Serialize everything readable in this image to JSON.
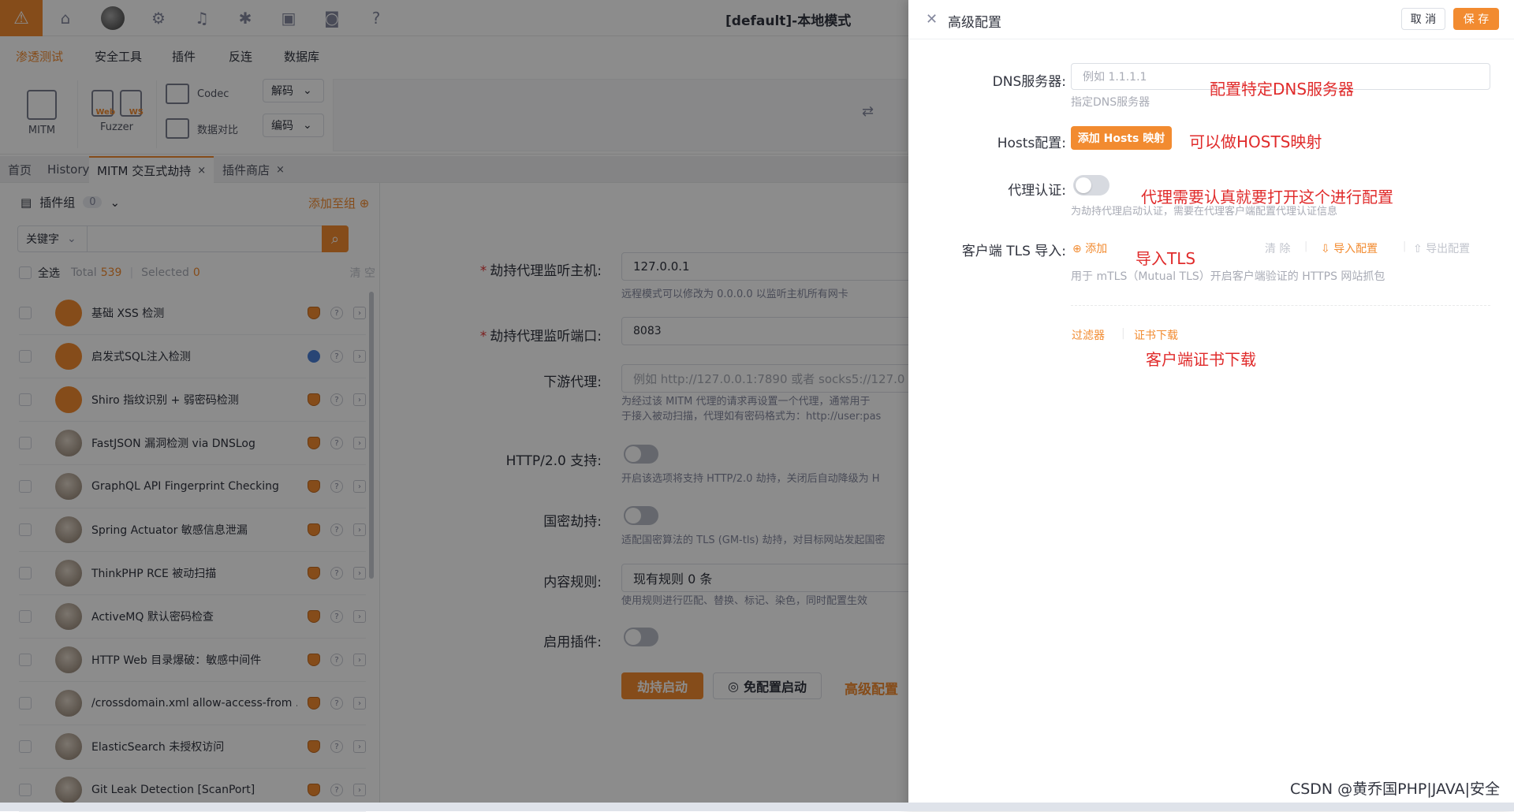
{
  "window": {
    "title": "[default]-本地模式"
  },
  "topbar": {
    "icons": [
      "warning-icon",
      "home-icon",
      "avatar",
      "settings-icon",
      "bell-icon",
      "bug-icon",
      "terminal-icon",
      "camera-icon",
      "help-icon"
    ]
  },
  "menu": [
    "渗透测试",
    "安全工具",
    "插件",
    "反连",
    "数据库"
  ],
  "tools": {
    "mitm": "MITM",
    "fuzzer": "Fuzzer",
    "codec": "Codec",
    "compare": "数据对比",
    "decode": "解码",
    "encode": "编码",
    "web_tag": "Web",
    "ws_tag": "WS"
  },
  "tabs": [
    {
      "label": "首页"
    },
    {
      "label": "History"
    },
    {
      "label": "MITM 交互式劫持",
      "close": "×"
    },
    {
      "label": "插件商店",
      "close": "×"
    }
  ],
  "plugins": {
    "group_label": "插件组",
    "group_count": "0",
    "add_to_group": "添加至组",
    "keyword_label": "关键字",
    "select_all": "全选",
    "total_label": "Total",
    "total": "539",
    "selected_label": "Selected",
    "selected": "0",
    "clear": "清 空",
    "items": [
      {
        "name": "基础 XSS 检测"
      },
      {
        "name": "启发式SQL注入检测"
      },
      {
        "name": "Shiro 指纹识别 + 弱密码检测"
      },
      {
        "name": "FastJSON 漏洞检测 via DNSLog"
      },
      {
        "name": "GraphQL API Fingerprint Checking"
      },
      {
        "name": "Spring Actuator 敏感信息泄漏"
      },
      {
        "name": "ThinkPHP RCE 被动扫描"
      },
      {
        "name": "ActiveMQ 默认密码检查"
      },
      {
        "name": "HTTP Web 目录爆破：敏感中间件"
      },
      {
        "name": "/crossdomain.xml allow-access-from ..."
      },
      {
        "name": "ElasticSearch 未授权访问"
      },
      {
        "name": "Git Leak Detection [ScanPort]"
      }
    ]
  },
  "mitm_form": {
    "host_label": "劫持代理监听主机:",
    "host_value": "127.0.0.1",
    "host_help": "远程模式可以修改为 0.0.0.0 以监听主机所有网卡",
    "port_label": "劫持代理监听端口:",
    "port_value": "8083",
    "downstream_label": "下游代理:",
    "downstream_placeholder": "例如 http://127.0.0.1:7890 或者 socks5://127.0",
    "downstream_help1": "为经过该 MITM 代理的请求再设置一个代理，通常用于",
    "downstream_help2": "于接入被动扫描，代理如有密码格式为：http://user:pas",
    "http2_label": "HTTP/2.0 支持:",
    "http2_help": "开启该选项将支持 HTTP/2.0 劫持，关闭后自动降级为 H",
    "gm_label": "国密劫持:",
    "gm_help": "适配国密算法的 TLS (GM-tls) 劫持，对目标网站发起国密",
    "rules_label": "内容规则:",
    "rules_value": "现有规则 0 条",
    "rules_help": "使用规则进行匹配、替换、标记、染色，同时配置生效",
    "enable_plugin_label": "启用插件:",
    "start_btn": "劫持启动",
    "free_start_btn": "免配置启动",
    "advanced_link": "高级配置"
  },
  "drawer": {
    "title": "高级配置",
    "cancel": "取 消",
    "save": "保 存",
    "dns_label": "DNS服务器:",
    "dns_placeholder": "例如 1.1.1.1",
    "dns_help": "指定DNS服务器",
    "hosts_label": "Hosts配置:",
    "hosts_btn": "添加 Hosts 映射",
    "proxy_auth_label": "代理认证:",
    "proxy_auth_help": "为劫持代理启动认证，需要在代理客户端配置代理认证信息",
    "tls_label": "客户端 TLS 导入:",
    "tls_add": "添加",
    "tls_clear": "清 除",
    "tls_import": "导入配置",
    "tls_export": "导出配置",
    "tls_help": "用于 mTLS（Mutual TLS）开启客户端验证的 HTTPS 网站抓包",
    "filter_link": "过滤器",
    "cert_link": "证书下载"
  },
  "annotations": {
    "dns": "配置特定DNS服务器",
    "hosts": "可以做HOSTS映射",
    "proxy_auth": "代理需要认真就要打开这个进行配置",
    "tls": "导入TLS",
    "cert": "客户端证书下载"
  },
  "watermark": "CSDN @黄乔国PHP|JAVA|安全",
  "colors": {
    "accent": "#f28b30",
    "annotation": "#e02b2b"
  }
}
